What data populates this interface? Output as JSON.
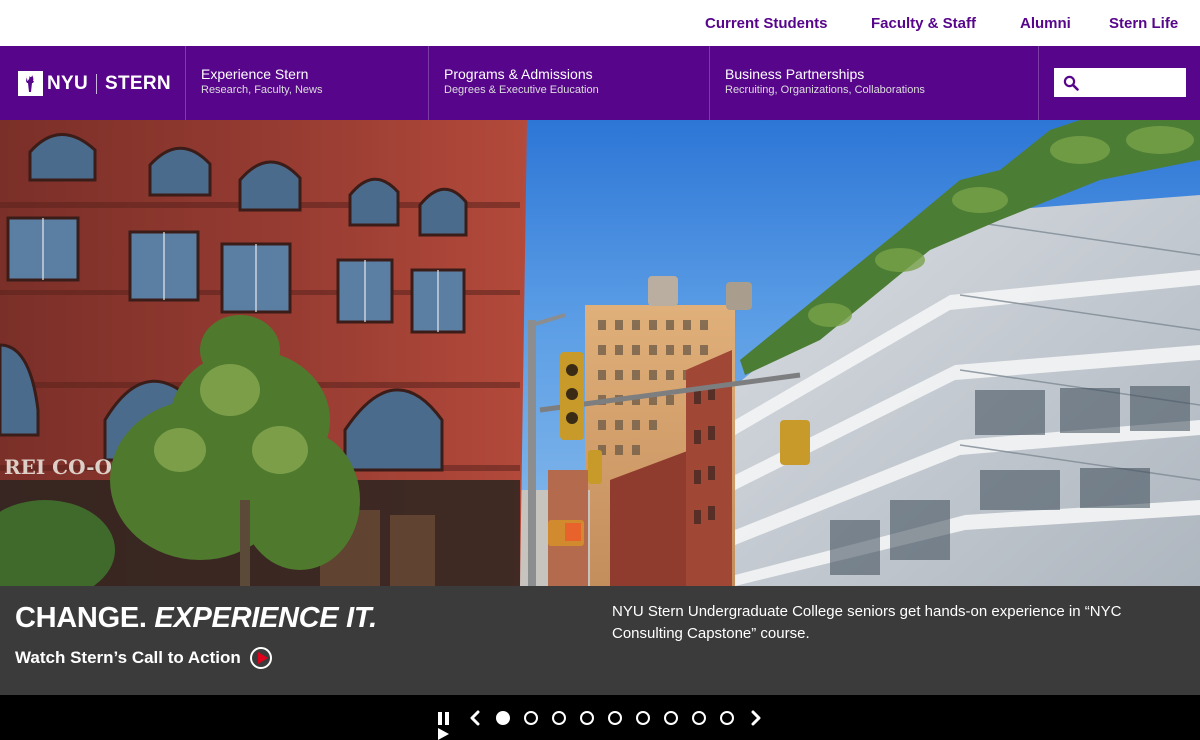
{
  "utility_nav": {
    "items": [
      "Current Students",
      "Faculty & Staff",
      "Alumni",
      "Stern Life"
    ]
  },
  "brand": {
    "name_left": "NYU",
    "name_right": "STERN",
    "color": "#57068c"
  },
  "main_nav": {
    "items": [
      {
        "title": "Experience Stern",
        "subtitle": "Research, Faculty, News"
      },
      {
        "title": "Programs & Admissions",
        "subtitle": "Degrees & Executive Education"
      },
      {
        "title": "Business Partnerships",
        "subtitle": "Recruiting, Organizations, Collaborations"
      }
    ],
    "search": {
      "icon": "search-icon",
      "value": "",
      "placeholder": ""
    }
  },
  "hero": {
    "scene": "nyc-street-photo",
    "headline_part1": "CHANGE.",
    "headline_part2": "EXPERIENCE IT.",
    "cta_label": "Watch Stern’s Call to Action",
    "description": "NYU Stern Undergraduate College seniors get hands-on experience in “NYC Consulting Capstone” course.",
    "play_icon_color": "#e0001b"
  },
  "carousel": {
    "slide_count": 9,
    "active_index": 0,
    "controls": [
      "pause-icon",
      "play-icon",
      "prev-arrow-icon",
      "next-arrow-icon"
    ]
  }
}
